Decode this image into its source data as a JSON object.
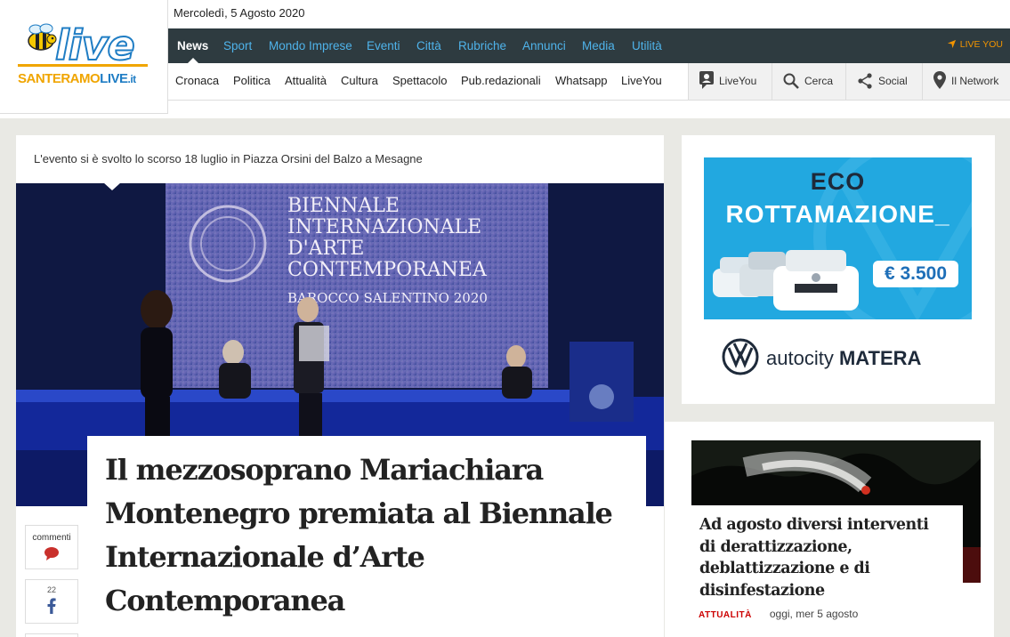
{
  "logo": {
    "live": "live",
    "name_part1": "SANTERAMO",
    "name_part2": "LIVE",
    "name_tld": ".it"
  },
  "header": {
    "date": "Mercoledì, 5 Agosto 2020",
    "live_you_label": "LIVE YOU"
  },
  "nav_primary": [
    "News",
    "Sport",
    "Mondo Imprese",
    "Eventi",
    "Città",
    "Rubriche",
    "Annunci",
    "Media",
    "Utilità"
  ],
  "nav_secondary": [
    "Cronaca",
    "Politica",
    "Attualità",
    "Cultura",
    "Spettacolo",
    "Pub.redazionali",
    "Whatsapp",
    "LiveYou"
  ],
  "tools": [
    "LiveYou",
    "Cerca",
    "Social",
    "Il Network"
  ],
  "article": {
    "caption": "L'evento si è svolto lo scorso 18 luglio in Piazza Orsini del Balzo a Mesagne",
    "title": "Il mezzosoprano Mariachiara Montenegro premiata al Biennale Internazionale d’Arte Contemporanea",
    "comments_label": "commenti",
    "facebook_count": "22",
    "photo_screen_text": [
      "BIENNALE",
      "INTERNAZIONALE",
      "D'ARTE",
      "CONTEMPORANEA",
      "BAROCCO SALENTINO 2020"
    ]
  },
  "ad": {
    "line1": "ECO",
    "line2": "ROTTAMAZIONE_",
    "price": "€ 3.500",
    "brand": "autocity",
    "city": "MATERA"
  },
  "related": {
    "title": "Ad agosto diversi interventi di derattizzazione, deblattizzazione e di disinfestazione",
    "category": "ATTUALITÀ",
    "time": "oggi, mer 5 agosto"
  },
  "colors": {
    "nav_dark": "#2e3b40",
    "nav_link": "#4fb3ea",
    "accent_orange": "#f29400",
    "ad_blue": "#22a8e0",
    "category_red": "#cc0000"
  }
}
